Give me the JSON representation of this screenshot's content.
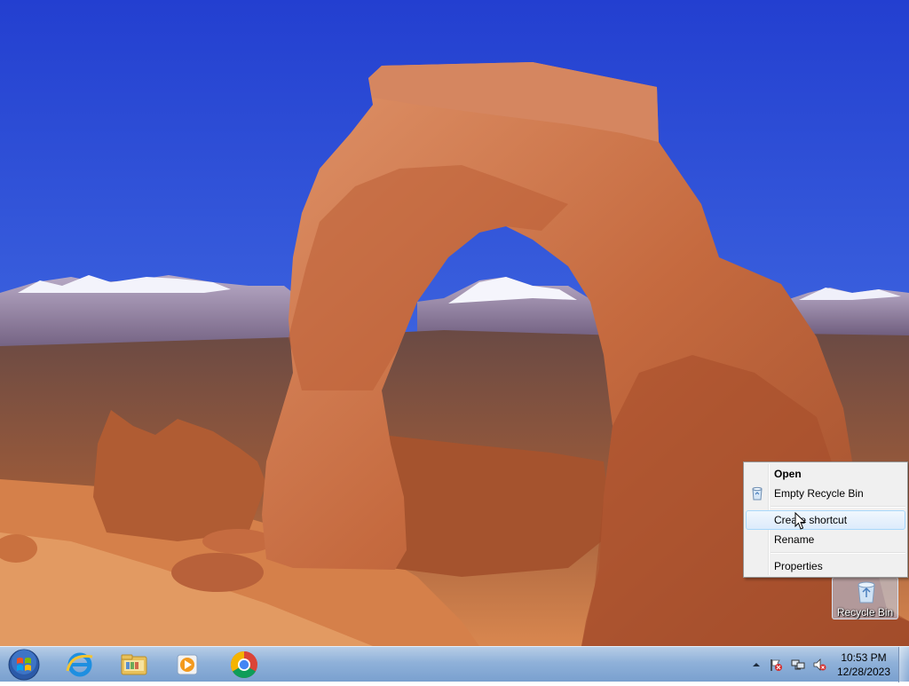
{
  "desktop": {
    "wallpaper_name": "delicate-arch-wallpaper",
    "icons": [
      {
        "label": "Recycle Bin",
        "icon": "recycle-bin-icon"
      }
    ]
  },
  "context_menu": {
    "items": [
      {
        "label": "Open",
        "bold": true
      },
      {
        "label": "Empty Recycle Bin",
        "icon": "recycle-bin-icon"
      },
      {
        "label": "Create shortcut",
        "highlighted": true
      },
      {
        "label": "Rename"
      },
      {
        "label": "Properties"
      }
    ]
  },
  "taskbar": {
    "start_icon": "windows-start-orb-icon",
    "pinned": [
      {
        "name": "Internet Explorer",
        "icon": "internet-explorer-icon"
      },
      {
        "name": "Windows Explorer",
        "icon": "folder-library-icon"
      },
      {
        "name": "Windows Media Player",
        "icon": "media-player-icon"
      },
      {
        "name": "Google Chrome",
        "icon": "chrome-icon"
      }
    ],
    "tray": {
      "icons": [
        "chevron-up-icon",
        "action-center-flag-icon",
        "network-icon",
        "volume-muted-icon"
      ],
      "time": "10:53 PM",
      "date": "12/28/2023"
    }
  },
  "colors": {
    "sky": "#2f4fd4",
    "taskbar": "#8fb1d9",
    "menu_highlight": "#dcebfc",
    "menu_bg": "#f0f0f0"
  }
}
